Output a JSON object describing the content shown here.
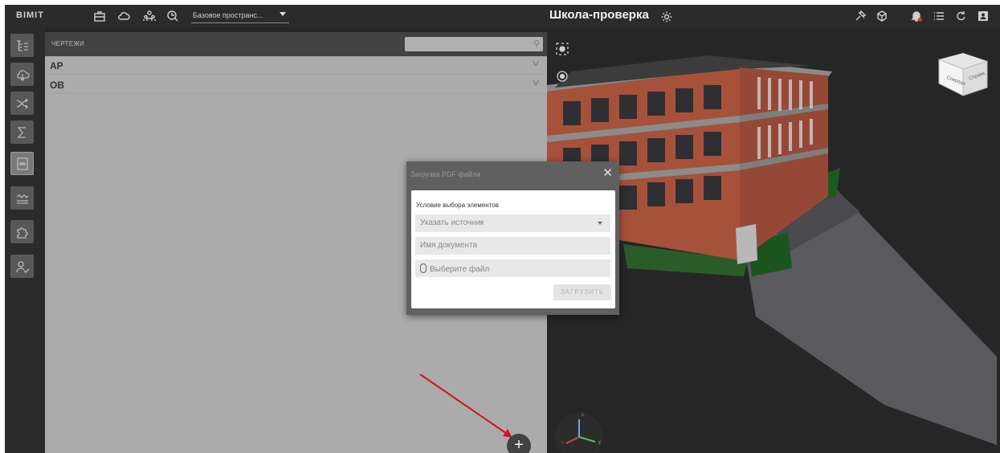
{
  "topbar": {
    "logo": "BIMIT",
    "space_select": "Базовое пространс...",
    "project_title": "Школа-проверка",
    "icons": [
      "briefcase-icon",
      "cloud-icon",
      "team-icon",
      "hanger-icon",
      "pin-icon",
      "cube-rotate-icon",
      "bell-icon",
      "list-icon",
      "refresh-icon",
      "user-card-icon"
    ]
  },
  "rail": {
    "icons": [
      "tree-icon",
      "cloud-swap-icon",
      "shuffle-icon",
      "sigma-icon",
      "drawing-2d-icon",
      "wave-layers-icon",
      "puzzle-icon",
      "user-check-icon"
    ]
  },
  "panel": {
    "title": "ЧЕРТЕЖИ",
    "rows": [
      {
        "label": "АР"
      },
      {
        "label": "ОВ"
      }
    ],
    "add_label": "+"
  },
  "modal": {
    "title": "Загрузка PDF файла",
    "close": "✕",
    "condition_label": "Условие выбора элементов",
    "source_placeholder": "Указать источник",
    "docname_placeholder": "Имя документа",
    "file_placeholder": "Выберите файл",
    "upload_button": "ЗАГРУЗИТЬ"
  },
  "viewport": {
    "view_cube_faces": [
      "Спереди",
      "Справа"
    ],
    "axes": [
      "z",
      "x",
      "y"
    ]
  },
  "colors": {
    "brick": "#a6513a",
    "dark_bg": "#262626",
    "panel_bg": "#ababab",
    "annotation_arrow": "#d0161b"
  }
}
